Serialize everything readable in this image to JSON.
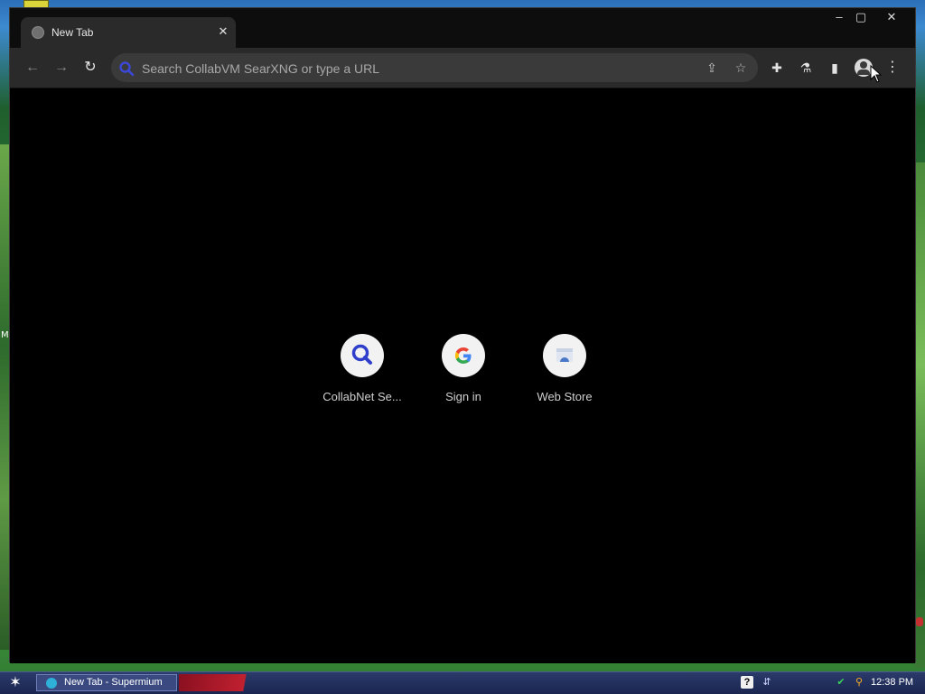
{
  "desktop": {
    "partial_label": "M"
  },
  "window": {
    "controls": {
      "minimize": "–",
      "maximize": "▢",
      "close": "✕"
    },
    "tab": {
      "title": "New Tab",
      "close": "✕"
    },
    "toolbar": {
      "back": "←",
      "forward": "→",
      "reload": "↻",
      "omnibox_placeholder": "Search CollabVM SearXNG or type a URL",
      "share": "⇪",
      "bookmark": "☆",
      "extensions": "✚",
      "labs": "⚗",
      "side_panel": "▮",
      "menu": "⋮"
    },
    "shortcuts": [
      {
        "label": "CollabNet Se...",
        "icon": "search-icon"
      },
      {
        "label": "Sign in",
        "icon": "google-icon"
      },
      {
        "label": "Web Store",
        "icon": "web-store-icon"
      }
    ]
  },
  "taskbar": {
    "start": "✶",
    "task_label": "New Tab - Supermium",
    "help_icon": "?",
    "network_icon": "⇵",
    "green_icon": "✔",
    "key_icon": "⚲",
    "clock": "12:38 PM"
  },
  "colors": {
    "window_bg": "#000000",
    "toolbar_bg": "#2a2a2a",
    "omnibox_bg": "#3a3a3a",
    "search_icon_blue": "#3b48d6",
    "taskbar_bg": "#1b2650"
  }
}
